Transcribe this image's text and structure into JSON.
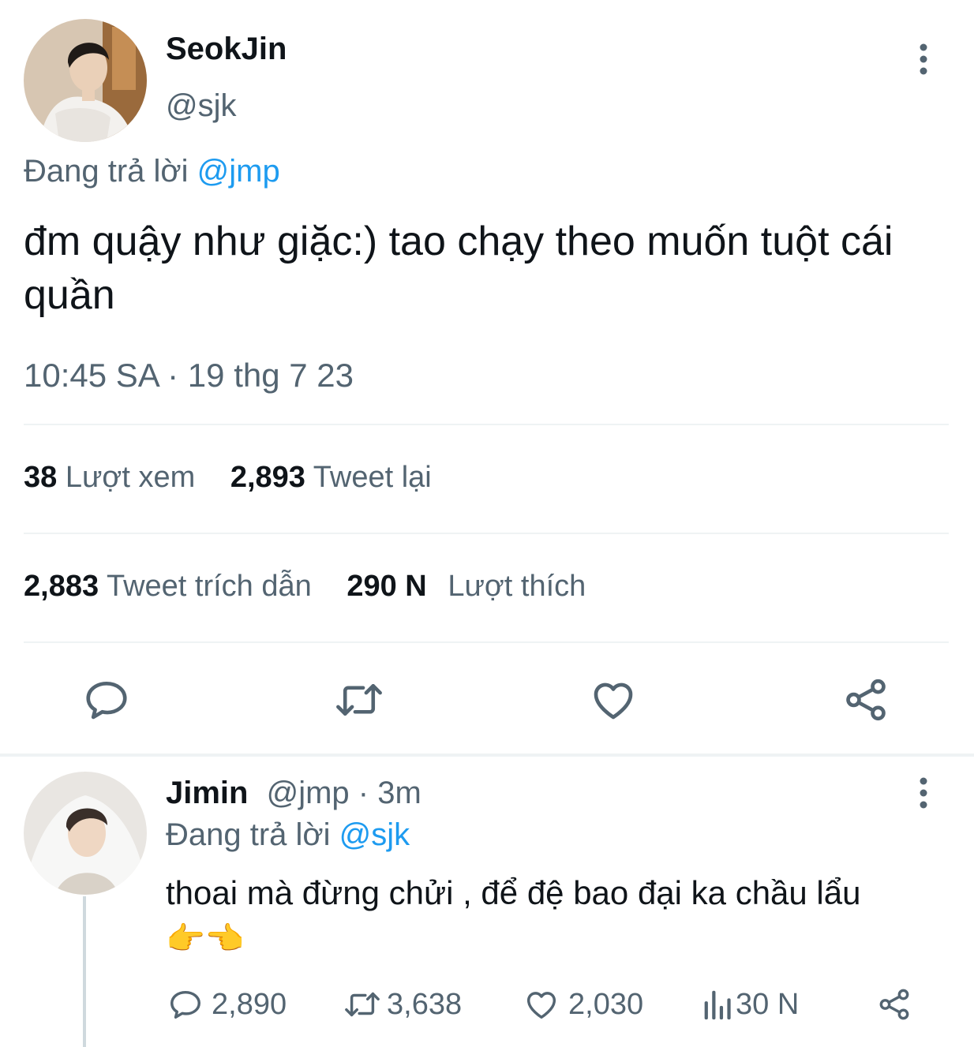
{
  "main_tweet": {
    "author_name": "SeokJin",
    "author_handle": "@sjk",
    "replying_prefix": "Đang trả lời",
    "replying_to": "@jmp",
    "text": "đm quậy như giặc:) tao chạy theo muốn tuột cái quần",
    "timestamp": "10:45 SA · 19 thg 7 23",
    "stats": {
      "views_count": "38",
      "views_label": "Lượt xem",
      "retweets_count": "2,893",
      "retweets_label": "Tweet lại",
      "quotes_count": "2,883",
      "quotes_label": "Tweet trích dẫn",
      "likes_count": "290 N",
      "likes_label": "Lượt thích"
    },
    "actions": [
      "reply-icon",
      "retweet-icon",
      "like-icon",
      "share-icon"
    ]
  },
  "reply_tweet": {
    "author_name": "Jimin",
    "author_handle": "@jmp",
    "time": "· 3m",
    "replying_prefix": "Đang trả lời",
    "replying_to": "@sjk",
    "text": "thoai mà đừng chửi , để đệ bao đại ka chầu lẩu",
    "emoji": "👉👈",
    "counts": {
      "replies": "2,890",
      "retweets": "3,638",
      "likes": "2,030",
      "views": "30 N"
    }
  },
  "colors": {
    "link": "#1d9bf0",
    "muted": "#536471",
    "divider": "#eff3f4"
  }
}
